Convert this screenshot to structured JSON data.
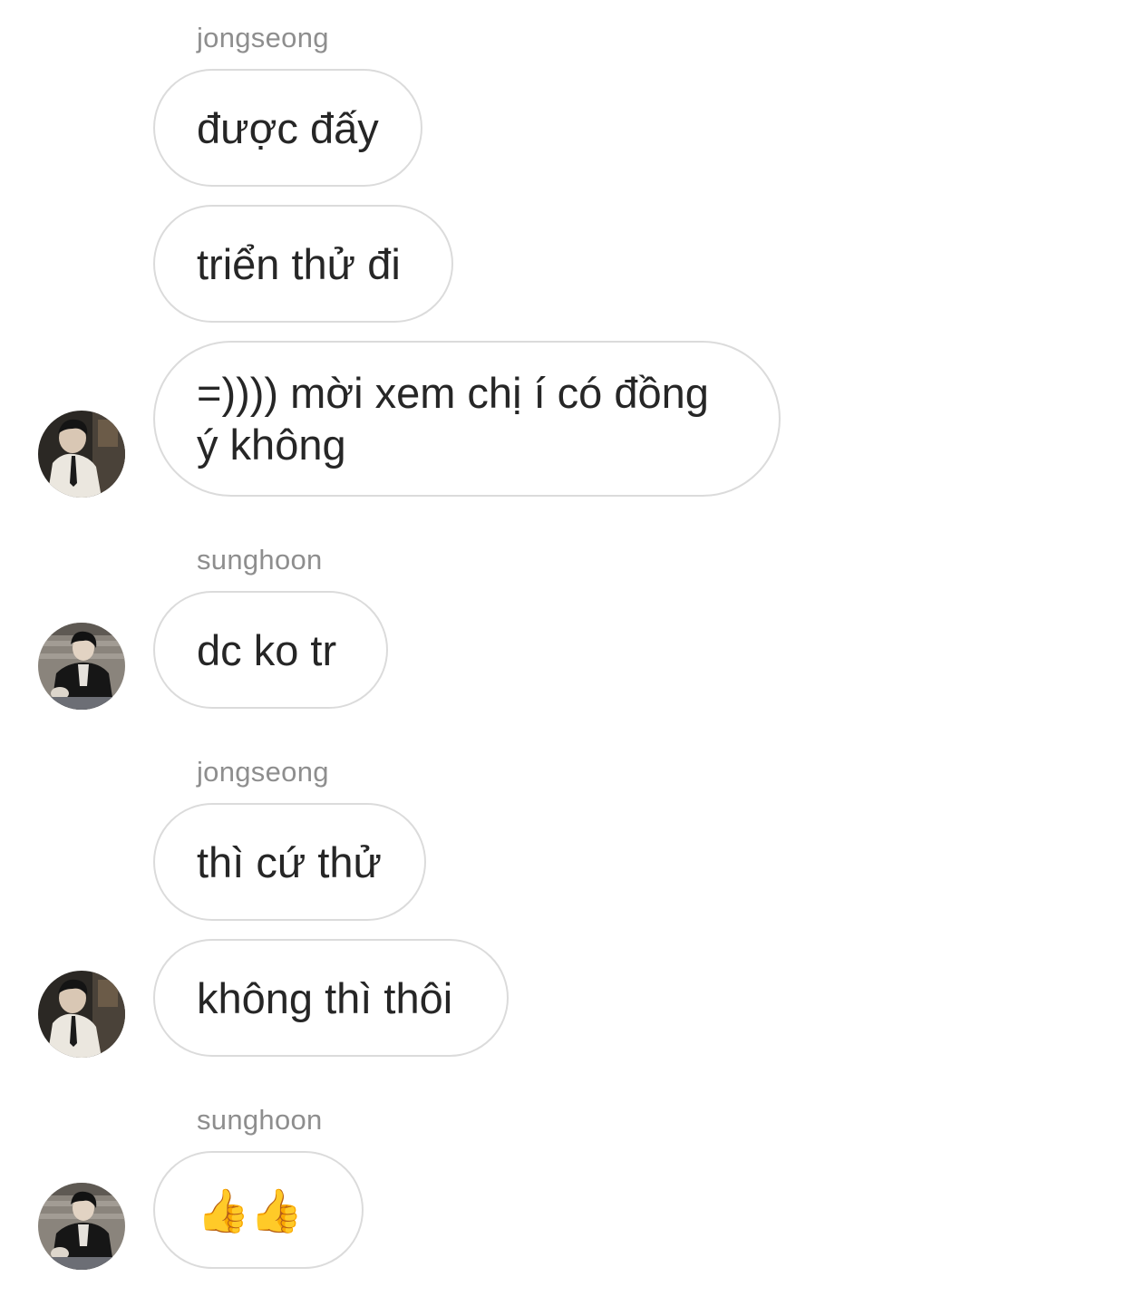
{
  "conversation": {
    "groups": [
      {
        "sender": "jongseong",
        "messages": [
          "được đấy",
          "triển thử đi",
          "=)))) mời xem chị í có đồng ý không"
        ]
      },
      {
        "sender": "sunghoon",
        "messages": [
          "dc ko tr"
        ]
      },
      {
        "sender": "jongseong",
        "messages": [
          "thì cứ thử",
          "không thì thôi"
        ]
      },
      {
        "sender": "sunghoon",
        "messages": [
          "👍👍"
        ]
      }
    ]
  },
  "avatars": {
    "jongseong": {
      "icon": "profile-photo-jongseong",
      "tones": [
        "#3a3530",
        "#e8e4dc",
        "#1c1c1c"
      ]
    },
    "sunghoon": {
      "icon": "profile-photo-sunghoon",
      "tones": [
        "#6b6660",
        "#151515",
        "#d8d4ce"
      ]
    }
  },
  "colors": {
    "background": "#ffffff",
    "bubble_border": "#dbdbdb",
    "text": "#262626",
    "sender_name": "#8e8e8e"
  }
}
